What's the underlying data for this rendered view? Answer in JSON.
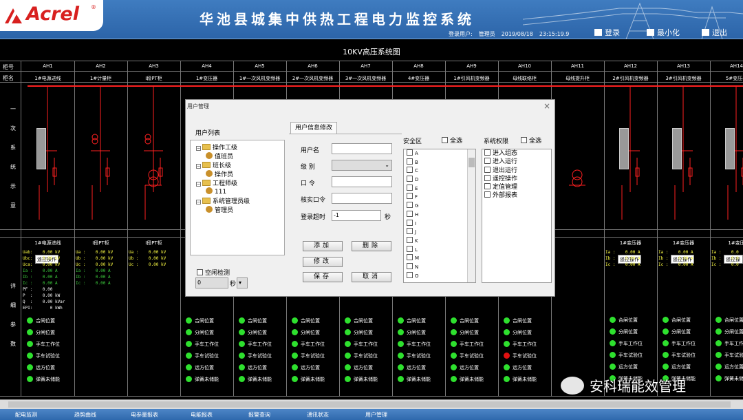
{
  "header": {
    "logo_text": "Acrel",
    "logo_reg": "®",
    "system_title": "华池县城集中供热工程电力监控系统",
    "login_user_label": "登录用户:",
    "login_user": "管理员",
    "date": "2019/08/18",
    "time": "23:15:19.9",
    "login_btn": "登录",
    "minimize_btn": "最小化",
    "exit_btn": "退出"
  },
  "diagram": {
    "title": "10KV高压系统图",
    "row_no_label": "柜号",
    "row_name_label": "柜名",
    "section_primary": [
      "一",
      "次",
      "系",
      "统",
      "示",
      "意"
    ],
    "section_detail": [
      "详",
      "细",
      "参",
      "数"
    ],
    "cabinets": [
      {
        "no": "AH1",
        "name": "1#电源进线"
      },
      {
        "no": "AH2",
        "name": "1#计量柜"
      },
      {
        "no": "AH3",
        "name": "I段PT柜"
      },
      {
        "no": "AH4",
        "name": "1#变压器"
      },
      {
        "no": "AH5",
        "name": "1#一次风机变频器"
      },
      {
        "no": "AH6",
        "name": "2#一次风机变频器"
      },
      {
        "no": "AH7",
        "name": "3#一次风机变频器"
      },
      {
        "no": "AH8",
        "name": "4#变压器"
      },
      {
        "no": "AH9",
        "name": "1#引风机变频器"
      },
      {
        "no": "AH10",
        "name": "母线联络柜"
      },
      {
        "no": "AH11",
        "name": "母线提升柜"
      },
      {
        "no": "AH12",
        "name": "2#引风机变频器"
      },
      {
        "no": "AH13",
        "name": "3#引风机变频器"
      },
      {
        "no": "AH14",
        "name": "5#变压器"
      }
    ],
    "remote_op": "遥控操作",
    "status_items": [
      "合闸位置",
      "分闸位置",
      "手车工作位",
      "手车试验位",
      "远方位置",
      "弹簧未储能"
    ],
    "blocks": [
      {
        "title": "1#电源进线",
        "lines": [
          "Uab:    0.00 kV",
          "Ubc:    0.00 kV",
          "Uca:    0.00 kV",
          "Ia :    0.00 A",
          "Ib :    0.00 A",
          "Ic :    0.00 A",
          "PF :    0.00",
          "P  :    0.00 kW",
          "Q  :    0.00 kVar",
          "EPI:       0 kWh"
        ]
      },
      {
        "title": "I段PT柜",
        "lines": [
          "Ua :    0.00 kV",
          "Ub :    0.00 kV",
          "Uc :    0.00 kV",
          "Ia :    0.00 A",
          "Ib :    0.00 A",
          "Ic :    0.00 A"
        ]
      },
      {
        "title": "I段PT柜",
        "lines": [
          "Ua :    0.00 kV",
          "Ub :    0.00 kV",
          "Uc :    0.00 kV"
        ]
      },
      {
        "title": "1#变压器",
        "lines": [
          "Ia :    0.00 A",
          "Ib :    0.00 A",
          "Ic :    0.00 A"
        ]
      },
      {
        "title": "1#变压器",
        "lines": [
          "Ia :    0.00 A",
          "Ib :    0.00 A",
          "Ic :    0.00 A"
        ]
      },
      {
        "title": "1#变压",
        "lines": [
          "Ia :    0.0",
          "Ib :    0.0",
          "Ic :    0.0"
        ]
      }
    ]
  },
  "dialog": {
    "title": "用户管理",
    "close": "×",
    "user_list_label": "用户列表",
    "tab": "用户信息修改",
    "tree": [
      {
        "label": "操作工级",
        "kind": "group"
      },
      {
        "label": "值班员",
        "kind": "user"
      },
      {
        "label": "班长级",
        "kind": "group"
      },
      {
        "label": "操作员",
        "kind": "user"
      },
      {
        "label": "工程师级",
        "kind": "group"
      },
      {
        "label": "111",
        "kind": "user"
      },
      {
        "label": "系统管理员级",
        "kind": "group"
      },
      {
        "label": "管理员",
        "kind": "user"
      }
    ],
    "username_label": "用户名",
    "level_label": "级    别",
    "password_label": "口    令",
    "confirm_label": "核实口令",
    "timeout_label": "登录超时",
    "timeout_value": "-1",
    "timeout_unit": "秒",
    "idle_check_label": "空闲检测",
    "idle_value": "0",
    "idle_unit": "秒",
    "zone_label": "安全区",
    "select_all": "全选",
    "perm_label": "系统权限",
    "zones": [
      "A",
      "B",
      "C",
      "D",
      "E",
      "F",
      "G",
      "H",
      "I",
      "J",
      "K",
      "L",
      "M",
      "N",
      "O"
    ],
    "perms": [
      "进入组态",
      "进入运行",
      "退出运行",
      "遥控操作",
      "定值管理",
      "外部报表"
    ],
    "btn_add": "添加",
    "btn_delete": "删除",
    "btn_modify": "修改",
    "btn_save": "保存",
    "btn_cancel": "取消"
  },
  "taskbar": [
    "配电监测",
    "趋势曲线",
    "电参量报表",
    "电能报表",
    "报警查询",
    "通讯状态",
    "用户管理"
  ],
  "watermark": "安科瑞能效管理",
  "colors": {
    "busbar": "#ff2020",
    "on": "#2ee02e",
    "alarm": "#e01010",
    "header": "#2c64a8"
  }
}
